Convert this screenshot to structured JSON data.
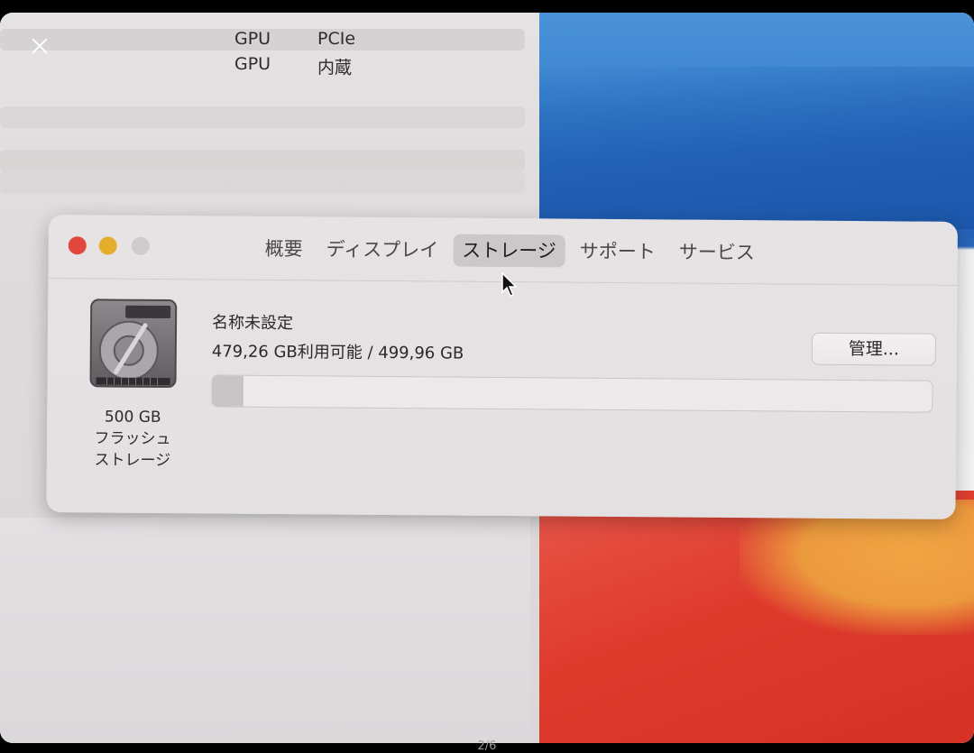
{
  "viewer": {
    "counter": "2/6",
    "close_icon": "close-icon"
  },
  "background_window": {
    "rows": [
      {
        "col1": "GPU",
        "col2": "PCIe"
      },
      {
        "col1": "GPU",
        "col2": "内蔵"
      }
    ]
  },
  "about_window": {
    "tabs": [
      {
        "label": "概要"
      },
      {
        "label": "ディスプレイ"
      },
      {
        "label": "ストレージ",
        "active": true
      },
      {
        "label": "サポート"
      },
      {
        "label": "サービス"
      }
    ],
    "disk": {
      "caption_line1": "500 GB",
      "caption_line2": "フラッシュ",
      "caption_line3": "ストレージ",
      "icon": "hard-drive-icon"
    },
    "volume": {
      "name": "名称未設定",
      "availability": "479,26 GB利用可能 / 499,96 GB",
      "used_fraction": 0.041
    },
    "manage_button": "管理..."
  },
  "colors": {
    "close": "#e2463d",
    "minimize": "#e6ad2a",
    "zoom_inactive": "#cfcccd"
  }
}
